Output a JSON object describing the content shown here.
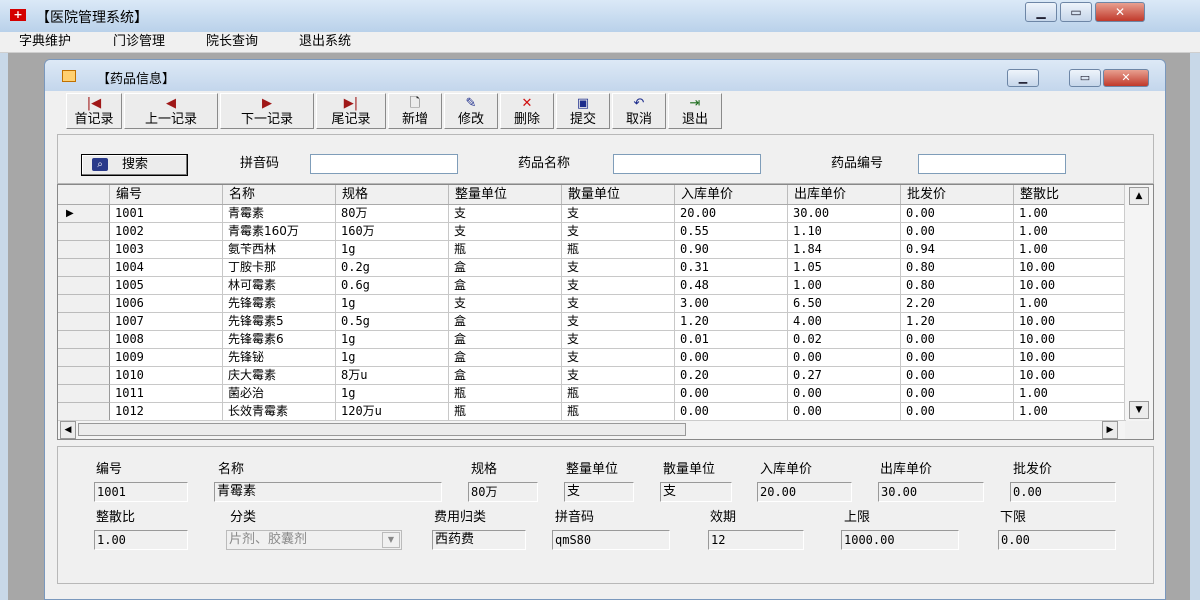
{
  "app": {
    "title": "【医院管理系统】",
    "icon": "swiss-cross-icon"
  },
  "menu": [
    "字典维护",
    "门诊管理",
    "院长查询",
    "退出系统"
  ],
  "child": {
    "title": "【药品信息】"
  },
  "toolbar": [
    {
      "label": "首记录",
      "icon": "first-record-icon",
      "glyph": "|◀"
    },
    {
      "label": "上一记录",
      "icon": "prev-record-icon",
      "glyph": "◀"
    },
    {
      "label": "下一记录",
      "icon": "next-record-icon",
      "glyph": "▶"
    },
    {
      "label": "尾记录",
      "icon": "last-record-icon",
      "glyph": "▶|"
    },
    {
      "label": "新增",
      "icon": "new-icon",
      "glyph": "🗋"
    },
    {
      "label": "修改",
      "icon": "edit-icon",
      "glyph": "✎"
    },
    {
      "label": "删除",
      "icon": "delete-icon",
      "glyph": "✕"
    },
    {
      "label": "提交",
      "icon": "save-icon",
      "glyph": "▣"
    },
    {
      "label": "取消",
      "icon": "undo-icon",
      "glyph": "↶"
    },
    {
      "label": "退出",
      "icon": "exit-icon",
      "glyph": "⇥"
    }
  ],
  "search": {
    "button_label": "搜索",
    "pinyin_label": "拼音码",
    "pinyin_value": "",
    "name_label": "药品名称",
    "name_value": "",
    "code_label": "药品编号",
    "code_value": ""
  },
  "grid": {
    "columns": [
      "编号",
      "名称",
      "规格",
      "整量单位",
      "散量单位",
      "入库单价",
      "出库单价",
      "批发价",
      "整散比"
    ],
    "current_row": 0,
    "rows": [
      [
        "1001",
        "青霉素",
        "80万",
        "支",
        "支",
        "20.00",
        "30.00",
        "0.00",
        "1.00"
      ],
      [
        "1002",
        "青霉素160万",
        "160万",
        "支",
        "支",
        "0.55",
        "1.10",
        "0.00",
        "1.00"
      ],
      [
        "1003",
        "氨苄西林",
        "1g",
        "瓶",
        "瓶",
        "0.90",
        "1.84",
        "0.94",
        "1.00"
      ],
      [
        "1004",
        "丁胺卡那",
        "0.2g",
        "盒",
        "支",
        "0.31",
        "1.05",
        "0.80",
        "10.00"
      ],
      [
        "1005",
        "林可霉素",
        "0.6g",
        "盒",
        "支",
        "0.48",
        "1.00",
        "0.80",
        "10.00"
      ],
      [
        "1006",
        "先锋霉素",
        "1g",
        "支",
        "支",
        "3.00",
        "6.50",
        "2.20",
        "1.00"
      ],
      [
        "1007",
        "先锋霉素5",
        "0.5g",
        "盒",
        "支",
        "1.20",
        "4.00",
        "1.20",
        "10.00"
      ],
      [
        "1008",
        "先锋霉素6",
        "1g",
        "盒",
        "支",
        "0.01",
        "0.02",
        "0.00",
        "10.00"
      ],
      [
        "1009",
        "先锋铋",
        "1g",
        "盒",
        "支",
        "0.00",
        "0.00",
        "0.00",
        "10.00"
      ],
      [
        "1010",
        "庆大霉素",
        "8万u",
        "盒",
        "支",
        "0.20",
        "0.27",
        "0.00",
        "10.00"
      ],
      [
        "1011",
        "菌必治",
        "1g",
        "瓶",
        "瓶",
        "0.00",
        "0.00",
        "0.00",
        "1.00"
      ],
      [
        "1012",
        "长效青霉素",
        "120万u",
        "瓶",
        "瓶",
        "0.00",
        "0.00",
        "0.00",
        "1.00"
      ]
    ]
  },
  "detail": {
    "code": {
      "label": "编号",
      "value": "1001"
    },
    "name": {
      "label": "名称",
      "value": "青霉素"
    },
    "spec": {
      "label": "规格",
      "value": "80万"
    },
    "whole_unit": {
      "label": "整量单位",
      "value": "支"
    },
    "bulk_unit": {
      "label": "散量单位",
      "value": "支"
    },
    "in_price": {
      "label": "入库单价",
      "value": "20.00"
    },
    "out_price": {
      "label": "出库单价",
      "value": "30.00"
    },
    "wholesale": {
      "label": "批发价",
      "value": "0.00"
    },
    "ratio": {
      "label": "整散比",
      "value": "1.00"
    },
    "category": {
      "label": "分类",
      "value": "片剂、胶囊剂"
    },
    "fee_type": {
      "label": "费用归类",
      "value": "西药费"
    },
    "pinyin": {
      "label": "拼音码",
      "value": "qmS80"
    },
    "validity": {
      "label": "效期",
      "value": "12"
    },
    "upper": {
      "label": "上限",
      "value": "1000.00"
    },
    "lower": {
      "label": "下限",
      "value": "0.00"
    }
  }
}
